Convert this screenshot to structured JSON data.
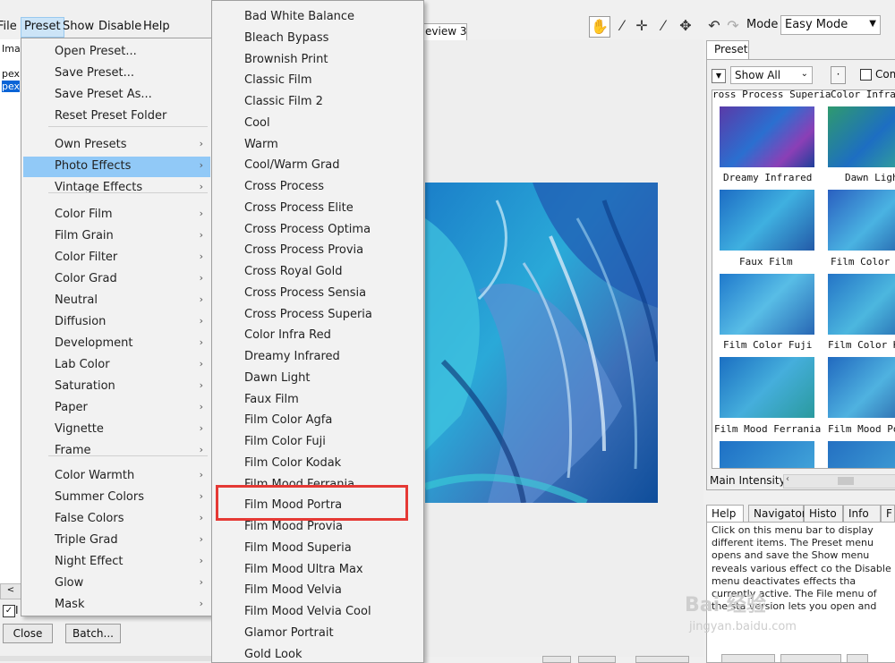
{
  "menubar": {
    "items": [
      "File",
      "Preset",
      "Show",
      "Disable",
      "Help"
    ]
  },
  "left_panel": {
    "header": "Imag",
    "items": [
      "pex",
      "pex"
    ],
    "scroll_left": "<",
    "checkbox_label": "I"
  },
  "preset_menu": {
    "items": [
      {
        "label": "Open Preset...",
        "submenu": false
      },
      {
        "label": "Save Preset...",
        "submenu": false
      },
      {
        "label": "Save Preset As...",
        "submenu": false
      },
      {
        "label": "Reset Preset Folder",
        "submenu": false
      },
      {
        "label": "Own Presets",
        "submenu": true
      },
      {
        "label": "Photo Effects",
        "submenu": true,
        "highlighted": true
      },
      {
        "label": "Vintage Effects",
        "submenu": true
      },
      {
        "label": "Color Film",
        "submenu": true
      },
      {
        "label": "Film Grain",
        "submenu": true
      },
      {
        "label": "Color Filter",
        "submenu": true
      },
      {
        "label": "Color Grad",
        "submenu": true
      },
      {
        "label": "Neutral",
        "submenu": true
      },
      {
        "label": "Diffusion",
        "submenu": true
      },
      {
        "label": "Development",
        "submenu": true
      },
      {
        "label": "Lab Color",
        "submenu": true
      },
      {
        "label": "Saturation",
        "submenu": true
      },
      {
        "label": "Paper",
        "submenu": true
      },
      {
        "label": "Vignette",
        "submenu": true
      },
      {
        "label": "Frame",
        "submenu": true
      },
      {
        "label": "Color Warmth",
        "submenu": true
      },
      {
        "label": "Summer Colors",
        "submenu": true
      },
      {
        "label": "False Colors",
        "submenu": true
      },
      {
        "label": "Triple Grad",
        "submenu": true
      },
      {
        "label": "Night Effect",
        "submenu": true
      },
      {
        "label": "Glow",
        "submenu": true
      },
      {
        "label": "Mask",
        "submenu": true
      }
    ],
    "arrow": "›"
  },
  "photo_effects_menu": {
    "items": [
      "Bad White Balance",
      "Bleach Bypass",
      "Brownish Print",
      "Classic Film",
      "Classic Film 2",
      "Cool",
      "Warm",
      "Cool/Warm Grad",
      "Cross Process",
      "Cross Process Elite",
      "Cross Process Optima",
      "Cross Process Provia",
      "Cross Royal Gold",
      "Cross Process Sensia",
      "Cross Process Superia",
      "Color Infra Red",
      "Dreamy Infrared",
      "Dawn Light",
      "Faux Film",
      "Film Color Agfa",
      "Film Color Fuji",
      "Film Color Kodak",
      "Film Mood Ferrania",
      "Film Mood Portra",
      "Film Mood Provia",
      "Film Mood Superia",
      "Film Mood Ultra Max",
      "Film Mood Velvia",
      "Film Mood Velvia Cool",
      "Glamor Portrait",
      "Gold Look"
    ],
    "highlighted": "Film Mood Portra"
  },
  "preview": {
    "tab_label": "eview 3"
  },
  "toolbar": {
    "hand": "✋",
    "picker": "⁄",
    "crosshair": "✛",
    "brush": "⁄",
    "move": "✥",
    "undo": "↶",
    "redo": "↷"
  },
  "mode": {
    "label": "Mode",
    "value": "Easy Mode"
  },
  "preset_panel": {
    "tab": "Preset",
    "show_all": "Show All",
    "dot_button": "·",
    "compare_label": "Com",
    "top_labels": [
      "ross Process Superia",
      "Color Infra"
    ],
    "thumb_labels": [
      "Dreamy Infrared",
      "Dawn Ligh",
      "Faux Film",
      "Film Color",
      "Film Color Fuji",
      "Film Color K",
      "Film Mood Ferrania",
      "Film Mood Po"
    ],
    "intensity_label": "Main Intensity"
  },
  "help": {
    "tabs": [
      "Help",
      "Navigator",
      "Histo",
      "Info",
      "F"
    ],
    "text": "Click on this menu bar to display different items. The Preset menu opens and save the Show menu reveals various effect co the Disable menu deactivates effects tha currently active. The File menu of the sta version lets you open and save image file other things."
  },
  "buttons": {
    "close": "Close",
    "batch": "Batch..."
  },
  "watermark": {
    "main": "Bai 经验",
    "url": "jingyan.baidu.com"
  },
  "colors": {
    "menu_bg": "#f2f2f2",
    "menu_highlight": "#91c9f7",
    "red_box": "#e53935"
  }
}
